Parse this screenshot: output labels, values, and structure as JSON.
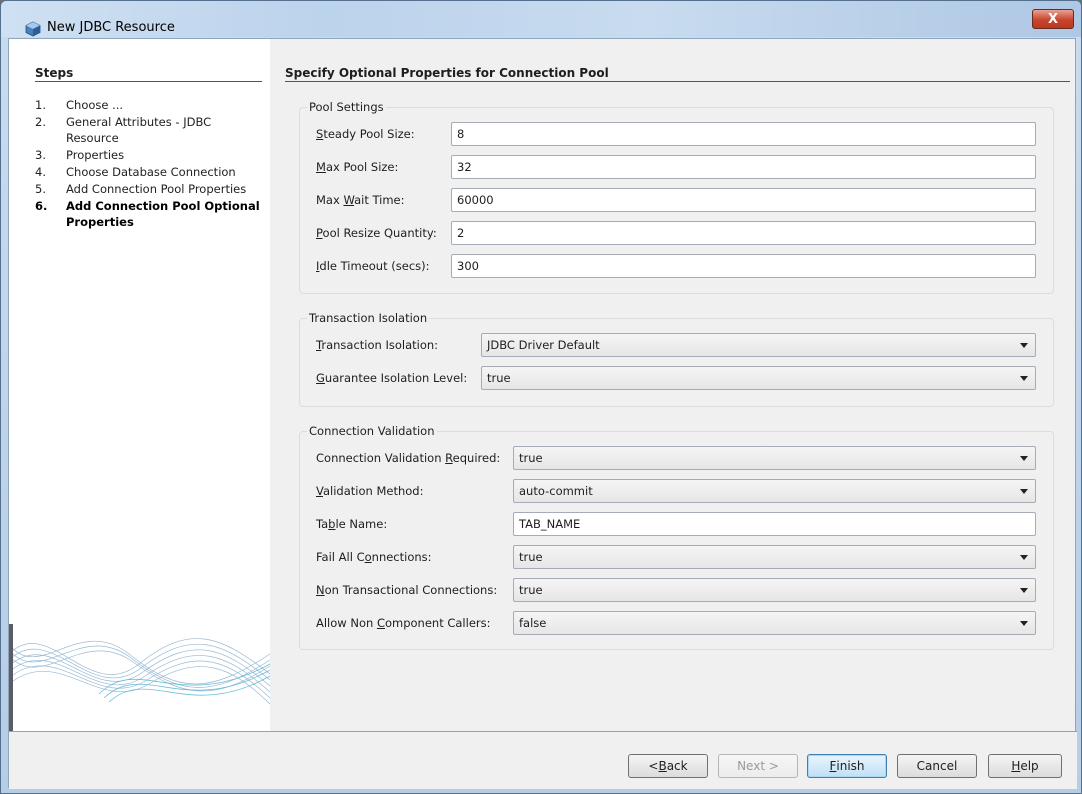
{
  "window": {
    "title": "New JDBC Resource",
    "close_glyph": "X"
  },
  "steps": {
    "heading": "Steps",
    "items": [
      {
        "num": "1.",
        "label": "Choose ..."
      },
      {
        "num": "2.",
        "label": "General Attributes - JDBC Resource"
      },
      {
        "num": "3.",
        "label": "Properties"
      },
      {
        "num": "4.",
        "label": "Choose Database Connection"
      },
      {
        "num": "5.",
        "label": "Add Connection Pool Properties"
      },
      {
        "num": "6.",
        "label": "Add Connection Pool Optional Properties",
        "current": true
      }
    ]
  },
  "main": {
    "heading": "Specify Optional Properties for Connection Pool",
    "pool_settings": {
      "title": "Pool Settings",
      "steady_pool_size": {
        "mnemonic": "S",
        "rest": "teady Pool Size:",
        "value": "8"
      },
      "max_pool_size": {
        "mnemonic": "M",
        "rest": "ax Pool Size:",
        "value": "32"
      },
      "max_wait_time": {
        "pre": "Max ",
        "mnemonic": "W",
        "rest": "ait Time:",
        "value": "60000"
      },
      "pool_resize_quantity": {
        "mnemonic": "P",
        "rest": "ool Resize Quantity:",
        "value": "2"
      },
      "idle_timeout": {
        "mnemonic": "I",
        "rest": "dle Timeout (secs):",
        "value": "300"
      }
    },
    "transaction_isolation": {
      "title": "Transaction Isolation",
      "isolation": {
        "mnemonic": "T",
        "rest": "ransaction Isolation:",
        "value": "JDBC Driver Default"
      },
      "guarantee": {
        "mnemonic": "G",
        "rest": "uarantee Isolation Level:",
        "value": "true"
      }
    },
    "connection_validation": {
      "title": "Connection Validation",
      "required": {
        "pre": "Connection Validation ",
        "mnemonic": "R",
        "rest": "equired:",
        "value": "true"
      },
      "method": {
        "mnemonic": "V",
        "rest": "alidation Method:",
        "value": "auto-commit"
      },
      "table_name": {
        "pre": "Ta",
        "mnemonic": "b",
        "rest": "le Name:",
        "value": "TAB_NAME"
      },
      "fail_all": {
        "pre": "Fail All C",
        "mnemonic": "o",
        "rest": "nnections:",
        "value": "true"
      },
      "non_transactional": {
        "mnemonic": "N",
        "rest": "on Transactional Connections:",
        "value": "true"
      },
      "non_component_callers": {
        "pre": "Allow Non ",
        "mnemonic": "C",
        "rest": "omponent Callers:",
        "value": "false"
      }
    }
  },
  "footer": {
    "back": {
      "pre": "< ",
      "mnemonic": "B",
      "rest": "ack"
    },
    "next": {
      "label": "Next >"
    },
    "finish": {
      "mnemonic": "F",
      "rest": "inish"
    },
    "cancel": {
      "label": "Cancel"
    },
    "help": {
      "mnemonic": "H",
      "rest": "elp"
    }
  },
  "colors": {
    "accent": "#3c7fb1",
    "close_red": "#c8452d",
    "window_frame": "#bcd3ec"
  },
  "icons": {
    "window": "netbeans-cube-icon",
    "close": "close-icon",
    "dropdown": "chevron-down-icon"
  }
}
